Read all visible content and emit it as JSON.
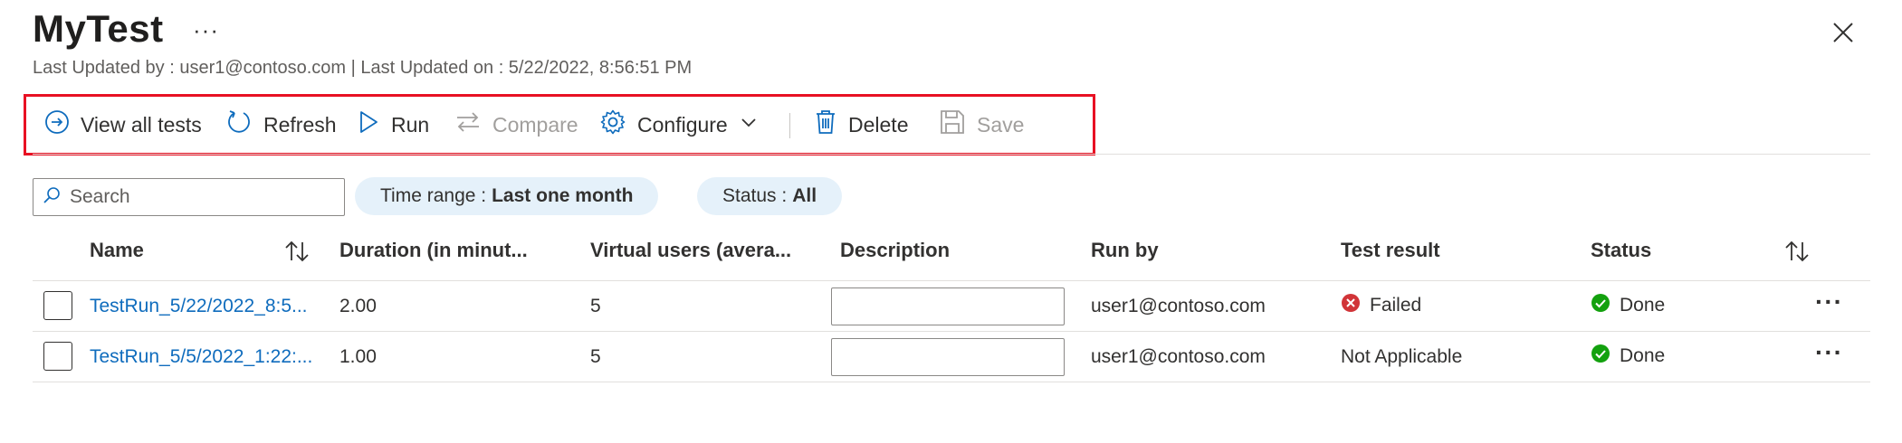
{
  "header": {
    "title": "MyTest",
    "more_label": "···",
    "subtitle": "Last Updated by : user1@contoso.com | Last Updated on : 5/22/2022, 8:56:51 PM"
  },
  "toolbar": {
    "view_all_tests": "View all tests",
    "refresh": "Refresh",
    "run": "Run",
    "compare": "Compare",
    "configure": "Configure",
    "delete": "Delete",
    "save": "Save"
  },
  "filters": {
    "search_placeholder": "Search",
    "time_range_label": "Time range :",
    "time_range_value": "Last one month",
    "status_label": "Status :",
    "status_value": "All"
  },
  "table": {
    "columns": {
      "name": "Name",
      "duration": "Duration (in minut...",
      "virtual_users": "Virtual users (avera...",
      "description": "Description",
      "run_by": "Run by",
      "test_result": "Test result",
      "status": "Status"
    },
    "rows": [
      {
        "name": "TestRun_5/22/2022_8:5...",
        "duration": "2.00",
        "virtual_users": "5",
        "description": "",
        "run_by": "user1@contoso.com",
        "test_result": "Failed",
        "status": "Done",
        "more": "···"
      },
      {
        "name": "TestRun_5/5/2022_1:22:...",
        "duration": "1.00",
        "virtual_users": "5",
        "description": "",
        "run_by": "user1@contoso.com",
        "test_result": "Not Applicable",
        "status": "Done",
        "more": "···"
      }
    ]
  },
  "colors": {
    "highlight_border": "#e81123",
    "link": "#0f6cbd",
    "icon_blue": "#0f6cbd",
    "failed_red": "#d13438",
    "done_green": "#13a10e",
    "pill_bg": "#e5f1fa"
  }
}
